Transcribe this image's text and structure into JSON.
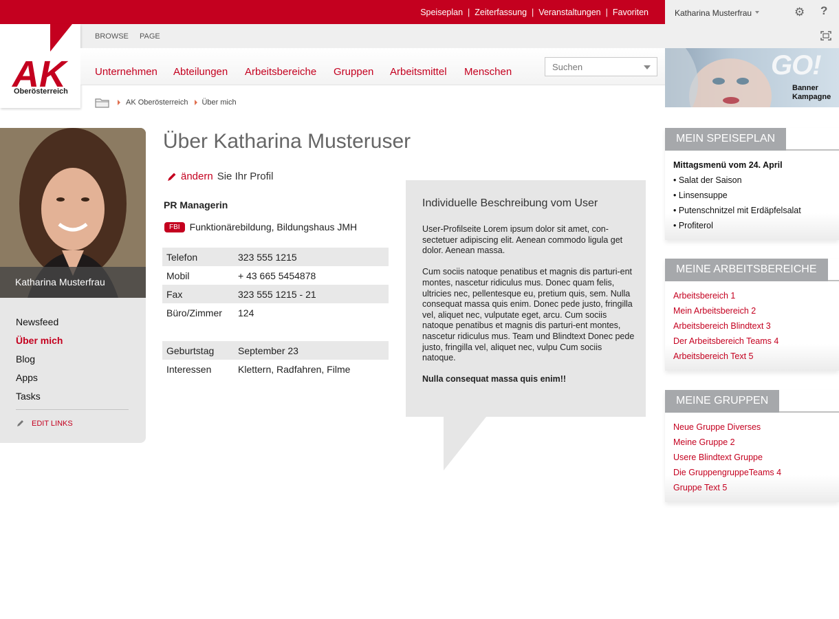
{
  "topbar": {
    "links": [
      "Speiseplan",
      "Zeiterfassung",
      "Veranstaltungen",
      "Favoriten"
    ],
    "separator": "|",
    "user_name": "Katharina Musterfrau",
    "help_label": "?"
  },
  "ribbon": {
    "tabs": [
      "BROWSE",
      "PAGE"
    ]
  },
  "logo": {
    "mark": "AK",
    "text": "Oberösterreich"
  },
  "nav": {
    "items": [
      "Unternehmen",
      "Abteilungen",
      "Arbeitsbereiche",
      "Gruppen",
      "Arbeitsmittel",
      "Menschen"
    ],
    "search_placeholder": "Suchen"
  },
  "banner": {
    "headline": "GO!",
    "line1": "Banner",
    "line2": "Kampagne"
  },
  "breadcrumb": {
    "items": [
      "AK Oberösterreich",
      "Über mich"
    ]
  },
  "profile": {
    "photo_name": "Katharina Musterfrau",
    "left_nav": [
      "Newsfeed",
      "Über mich",
      "Blog",
      "Apps",
      "Tasks"
    ],
    "active_nav": "Über mich",
    "edit_links": "EDIT LINKS",
    "title": "Über Katharina Musteruser",
    "edit_link": "ändern",
    "edit_text": "Sie Ihr Profil",
    "job_title": "PR Managerin",
    "dept_badge": "FBI",
    "dept": "Funktionärebildung, Bildungshaus JMH",
    "contact": [
      {
        "label": "Telefon",
        "value": "323 555 1215"
      },
      {
        "label": "Mobil",
        "value": "+ 43 665 5454878"
      },
      {
        "label": "Fax",
        "value": "323 555 1215 - 21"
      },
      {
        "label": "Büro/Zimmer",
        "value": "124"
      }
    ],
    "personal": [
      {
        "label": "Geburtstag",
        "value": "September 23"
      },
      {
        "label": "Interessen",
        "value": "Klettern, Radfahren, Filme"
      }
    ],
    "description_title": "Individuelle Beschreibung vom User",
    "description_p1": "User-Profilseite Lorem ipsum dolor sit amet, con-sectetuer adipiscing elit. Aenean commodo ligula get dolor. Aenean massa.",
    "description_p2": "Cum sociis natoque penatibus et magnis dis parturi-ent montes, nascetur ridiculus mus. Donec quam felis, ultricies nec, pellentesque eu, pretium quis, sem. Nulla consequat massa quis enim. Donec pede justo, fringilla vel, aliquet nec, vulputate eget, arcu. Cum sociis natoque penatibus et magnis dis parturi-ent montes, nascetur ridiculus mus. Team und Blindtext Donec pede justo, fringilla vel, aliquet nec, vulpu Cum sociis natoque.",
    "description_p3": "Nulla consequat massa quis enim!!"
  },
  "widgets": {
    "speiseplan": {
      "title": "MEIN SPEISEPLAN",
      "heading": "Mittagsmenü vom 24. April",
      "items": [
        "• Salat der Saison",
        "• Linsensuppe",
        "• Putenschnitzel mit Erdäpfelsalat",
        "• Profiterol"
      ]
    },
    "arbeitsbereiche": {
      "title": "MEINE ARBEITSBEREICHE",
      "items": [
        "Arbeitsbereich 1",
        "Mein Arbeitsbereich 2",
        "Arbeitsbereich Blindtext 3",
        "Der Arbeitsbereich Teams 4",
        "Arbeitsbereich Text 5"
      ]
    },
    "gruppen": {
      "title": "MEINE GRUPPEN",
      "items": [
        "Neue Gruppe Diverses",
        "Meine Gruppe 2",
        "Usere Blindtext Gruppe",
        "Die GruppengruppeTeams 4",
        "Gruppe Text 5"
      ]
    }
  },
  "colors": {
    "brand_red": "#c4001f",
    "widget_gray": "#a6a8ab",
    "panel_gray": "#e7e7e7"
  }
}
